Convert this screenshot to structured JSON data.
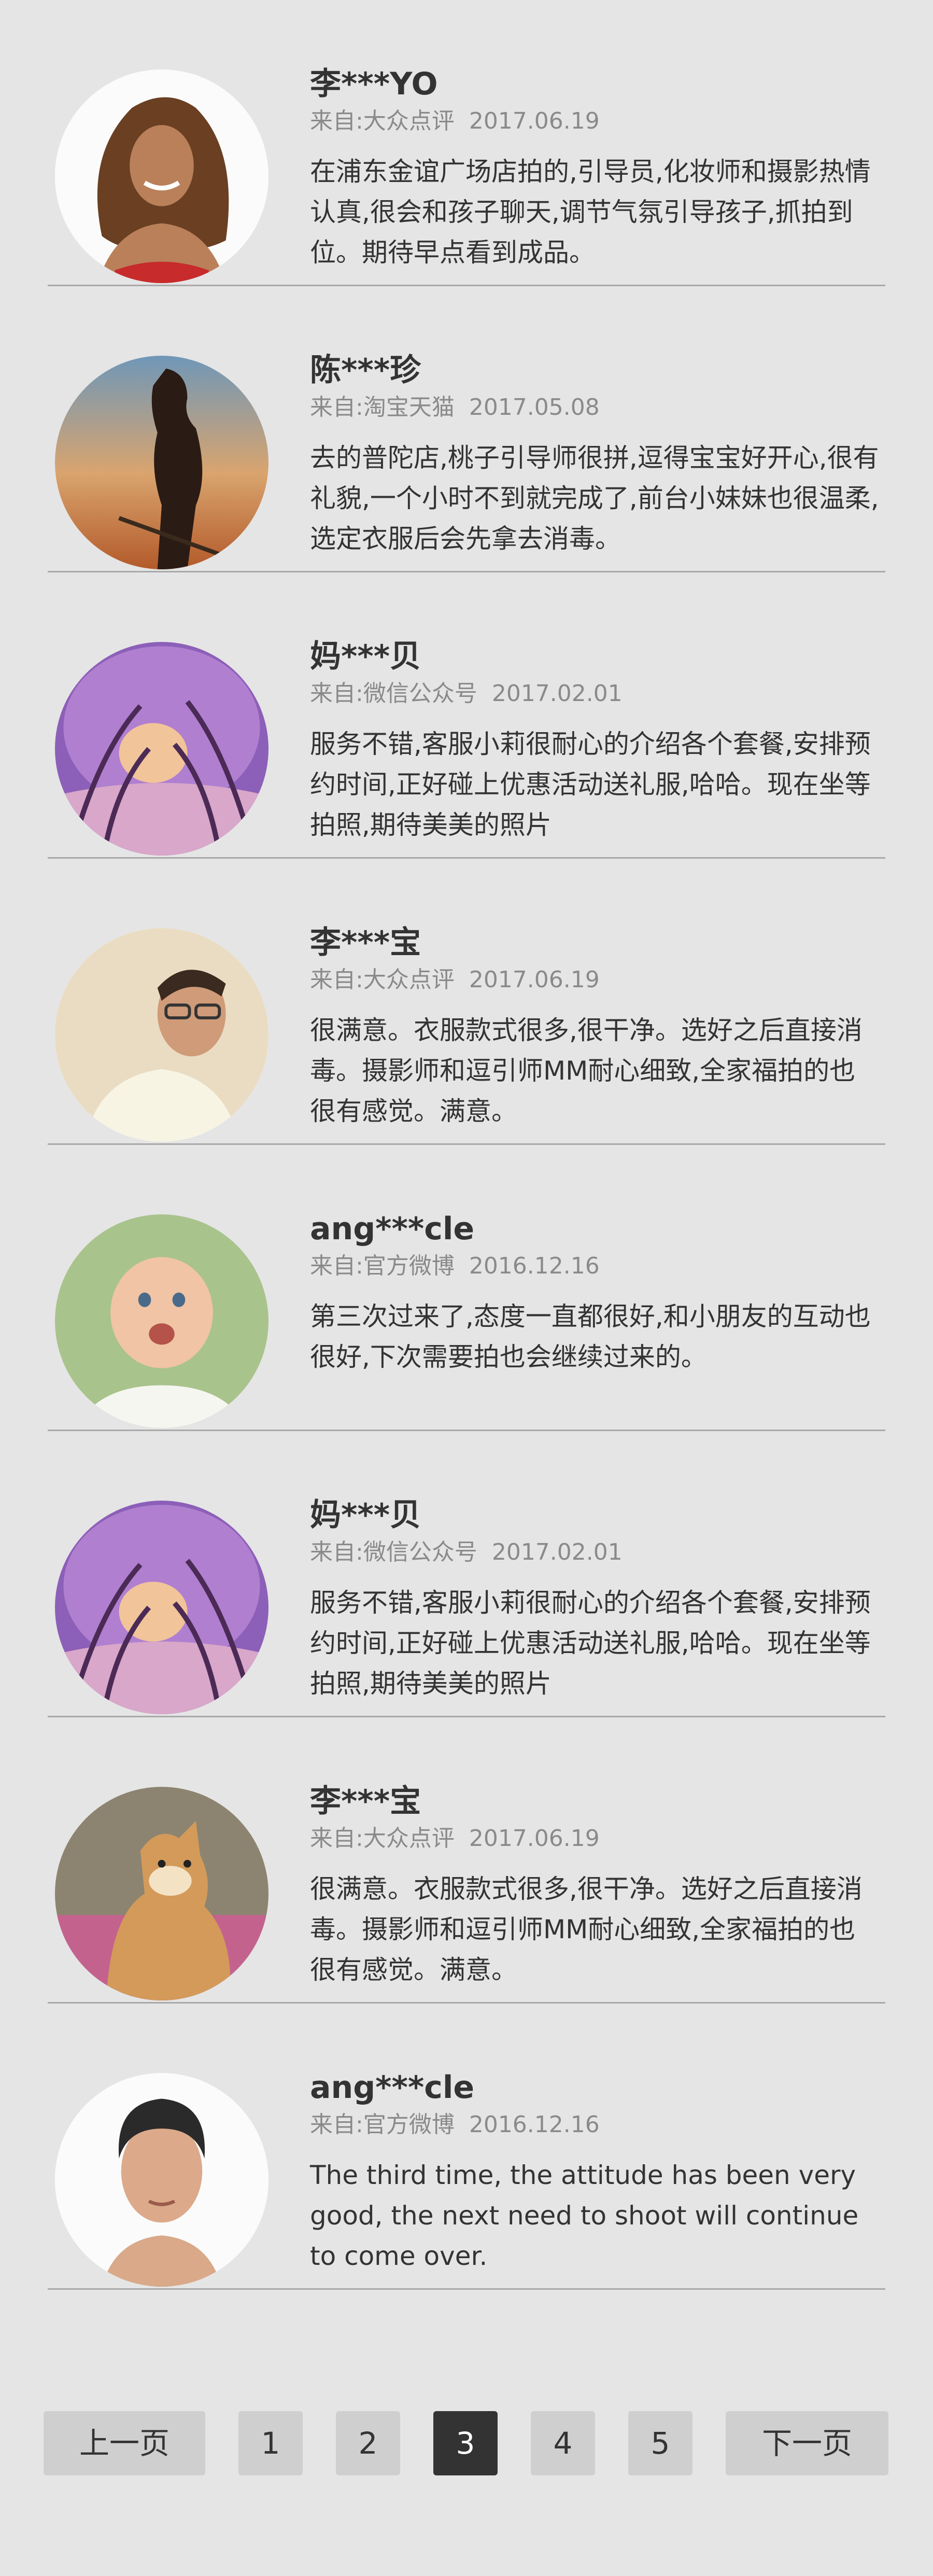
{
  "reviews": [
    {
      "name": "李***YO",
      "source": "来自:大众点评",
      "date": "2017.06.19",
      "text": "在浦东金谊广场店拍的,引导员,化妆师和摄影热情认真,很会和孩子聊天,调节气氛引导孩子,抓拍到位。期待早点看到成品。",
      "avatar": "woman-portrait-avatar"
    },
    {
      "name": "陈***珍",
      "source": "来自:淘宝天猫",
      "date": "2017.05.08",
      "text": "去的普陀店,桃子引导师很拼,逗得宝宝好开心,很有礼貌,一个小时不到就完成了,前台小妹妹也很温柔,选定衣服后会先拿去消毒。",
      "avatar": "warrior-silhouette-avatar"
    },
    {
      "name": "妈***贝",
      "source": "来自:微信公众号",
      "date": "2017.02.01",
      "text": "服务不错,客服小莉很耐心的介绍各个套餐,安排预约时间,正好碰上优惠活动送礼服,哈哈。现在坐等拍照,期待美美的照片",
      "avatar": "purple-tree-tunnel-avatar"
    },
    {
      "name": "李***宝",
      "source": "来自:大众点评",
      "date": "2017.06.19",
      "text": "很满意。衣服款式很多,很干净。选好之后直接消毒。摄影师和逗引师MM耐心细致,全家福拍的也很有感觉。满意。",
      "avatar": "man-glasses-avatar"
    },
    {
      "name": "ang***cle",
      "source": "来自:官方微博",
      "date": "2016.12.16",
      "text": "第三次过来了,态度一直都很好,和小朋友的互动也很好,下次需要拍也会继续过来的。",
      "avatar": "baby-avatar"
    },
    {
      "name": "妈***贝",
      "source": "来自:微信公众号",
      "date": "2017.02.01",
      "text": "服务不错,客服小莉很耐心的介绍各个套餐,安排预约时间,正好碰上优惠活动送礼服,哈哈。现在坐等拍照,期待美美的照片",
      "avatar": "purple-tree-tunnel-avatar"
    },
    {
      "name": "李***宝",
      "source": "来自:大众点评",
      "date": "2017.06.19",
      "text": "很满意。衣服款式很多,很干净。选好之后直接消毒。摄影师和逗引师MM耐心细致,全家福拍的也很有感觉。满意。",
      "avatar": "shiba-dog-avatar"
    },
    {
      "name": "ang***cle",
      "source": "来自:官方微博",
      "date": "2016.12.16",
      "text": "The third time, the attitude has been very good, the next need to shoot will continue to come over.",
      "avatar": "man-portrait-avatar"
    }
  ],
  "pagination": {
    "prev": "上一页",
    "pages": [
      "1",
      "2",
      "3",
      "4",
      "5"
    ],
    "current": "3",
    "next": "下一页"
  }
}
